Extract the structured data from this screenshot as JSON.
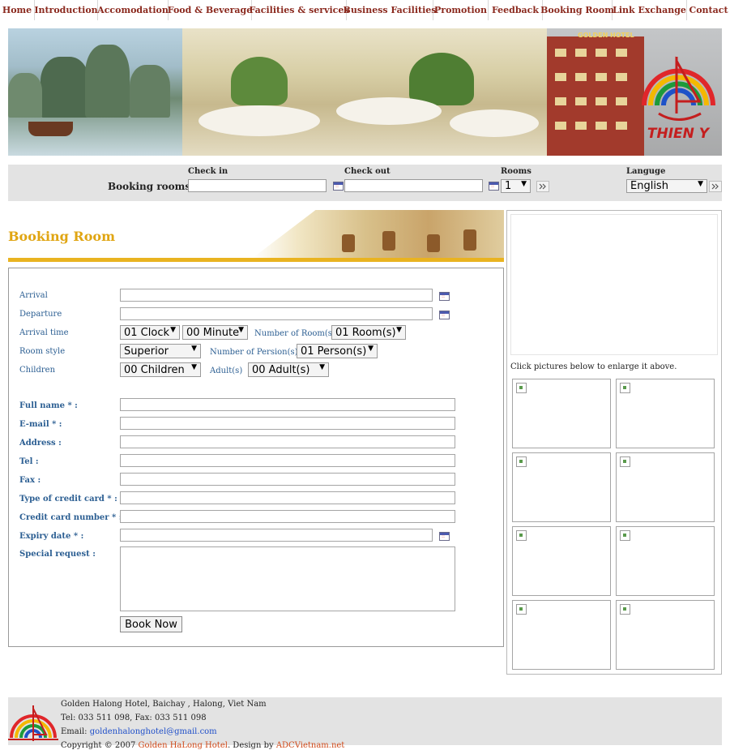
{
  "nav": {
    "items": [
      "Home",
      "Introduction",
      "Accomodation",
      "Food & Beverage",
      "Facilities & services",
      "Business Facilities",
      "Promotion",
      "Feedback",
      "Booking Room",
      "Link Exchange",
      "Contact"
    ]
  },
  "banner": {
    "logo_text": "THIEN Y",
    "sign_text": "GOLDEN HOTEL"
  },
  "booking_bar": {
    "label": "Booking rooms",
    "checkin_label": "Check in",
    "checkin_value": "",
    "checkout_label": "Check out",
    "checkout_value": "",
    "rooms_label": "Rooms",
    "rooms_value": "1",
    "language_label": "Languge",
    "language_value": "English"
  },
  "booking_room": {
    "title": "Booking Room"
  },
  "form": {
    "arrival_label": "Arrival",
    "arrival_value": "",
    "departure_label": "Departure",
    "departure_value": "",
    "arrival_time_label": "Arrival time",
    "hour_value": "01 Clock",
    "minute_value": "00 Minute",
    "num_rooms_label": "Number of Room(s)",
    "num_rooms_value": "01 Room(s)",
    "room_style_label": "Room style",
    "room_style_value": "Superior",
    "num_persons_label": "Number of Persion(s)",
    "num_persons_value": "01 Person(s)",
    "children_label": "Children",
    "children_value": "00 Children",
    "adults_label": "Adult(s)",
    "adults_value": "00 Adult(s)",
    "fullname_label": "Full name * :",
    "email_label": "E-mail * :",
    "address_label": "Address :",
    "tel_label": "Tel :",
    "fax_label": "Fax :",
    "card_type_label": "Type of credit card * :",
    "card_number_label": "Credit card number * :",
    "expiry_label": "Expiry date * :",
    "special_label": "Special request :",
    "book_now": "Book Now"
  },
  "gallery": {
    "note": "Click pictures below to enlarge it above."
  },
  "footer": {
    "line1": "Golden Halong Hotel, Baichay , Halong, Viet Nam",
    "line2": "Tel: 033 511 098, Fax: 033 511 098",
    "email_label": "Email: ",
    "email": "goldenhalonghotel@gmail.com",
    "copyright_prefix": "Copyright © 2007 ",
    "copyright_link": "Golden HaLong Hotel",
    "design_prefix": ". Design by ",
    "design_link": "ADCVietnam.net"
  },
  "colors": {
    "nav_text": "#8b2a1f",
    "title_gold": "#e0a512",
    "label_blue": "#2b5e92",
    "bar_gray": "#e3e3e3"
  }
}
